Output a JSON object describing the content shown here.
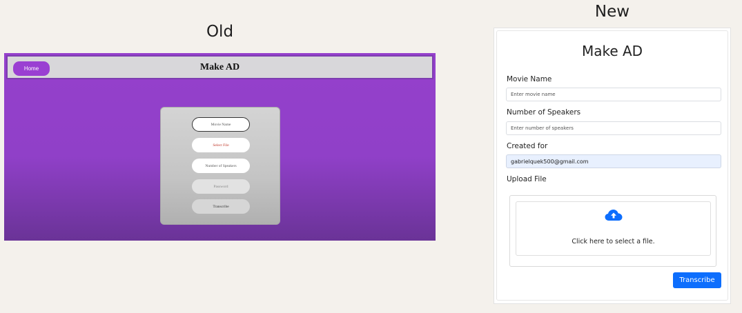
{
  "captions": {
    "old": "Old",
    "new": "New"
  },
  "old": {
    "home_label": "Home",
    "title": "Make AD",
    "fields": {
      "movie_name": "Movie Name",
      "select_file": "Select File",
      "speakers": "Number of Speakers",
      "password": "Password",
      "transcribe": "Transcribe"
    },
    "colors": {
      "background": "#9540cc",
      "home": "#9a3fd2"
    }
  },
  "new": {
    "title": "Make AD",
    "movie_name": {
      "label": "Movie Name",
      "placeholder": "Enter movie name",
      "value": ""
    },
    "speakers": {
      "label": "Number of Speakers",
      "placeholder": "Enter number of speakers",
      "value": ""
    },
    "created_for": {
      "label": "Created for",
      "value": "gabrielquek500@gmail.com"
    },
    "upload": {
      "label": "Upload File",
      "prompt": "Click here to select a file.",
      "icon": "cloud-upload-icon"
    },
    "transcribe_label": "Transcribe",
    "colors": {
      "primary": "#0d6efd",
      "autofill": "#e8f0fe"
    }
  }
}
